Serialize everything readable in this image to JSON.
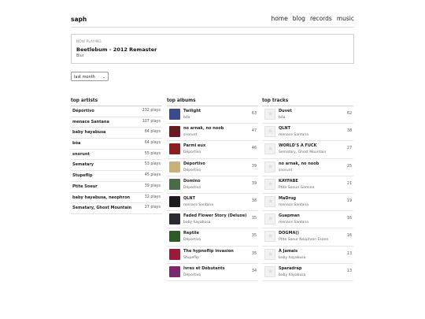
{
  "header": {
    "brand": "saph",
    "nav": [
      "home",
      "blog",
      "records",
      "music"
    ]
  },
  "now_playing": {
    "label": "NOW PLAYING",
    "title": "Beetlebum - 2012 Remaster",
    "artist": "Blur"
  },
  "period_select": {
    "value": "last month"
  },
  "top_artists": {
    "title": "top artists",
    "items": [
      {
        "name": "Déportivo",
        "plays": "232 plays"
      },
      {
        "name": "menace Santana",
        "plays": "107 plays"
      },
      {
        "name": "baby hayabusa",
        "plays": "84 plays"
      },
      {
        "name": "bôa",
        "plays": "64 plays"
      },
      {
        "name": "snorunt",
        "plays": "55 plays"
      },
      {
        "name": "Sematary",
        "plays": "53 plays"
      },
      {
        "name": "Stupeflip",
        "plays": "45 plays"
      },
      {
        "name": "Ptite Soeur",
        "plays": "39 plays"
      },
      {
        "name": "baby hayabusa, neophron",
        "plays": "32 plays"
      },
      {
        "name": "Sematary, Ghost Mountain",
        "plays": "27 plays"
      }
    ]
  },
  "top_albums": {
    "title": "top albums",
    "items": [
      {
        "name": "Twilight",
        "artist": "bôa",
        "count": "63",
        "color": "#3a4a8a"
      },
      {
        "name": "no arnak, no noob",
        "artist": "snorunt",
        "count": "47",
        "color": "#6a1a22"
      },
      {
        "name": "Parmi eux",
        "artist": "Déportivo",
        "count": "46",
        "color": "#8a1e22"
      },
      {
        "name": "Déportivo",
        "artist": "Déportivo",
        "count": "39",
        "color": "#c9b27a"
      },
      {
        "name": "Domino",
        "artist": "Déportivo",
        "count": "39",
        "color": "#4b6a4a"
      },
      {
        "name": "QLNT",
        "artist": "menace Santana",
        "count": "38",
        "color": "#1d1d1d"
      },
      {
        "name": "Faded Flower Story (Deluxe)",
        "artist": "baby hayabusa",
        "count": "35",
        "color": "#2a2a34"
      },
      {
        "name": "Reptile",
        "artist": "Déportivo",
        "count": "35",
        "color": "#2f5a2a"
      },
      {
        "name": "The hypnoflip invasion",
        "artist": "Stupeflip",
        "count": "35",
        "color": "#9a1a3a"
      },
      {
        "name": "Ivres et Débutants",
        "artist": "Déportivo",
        "count": "34",
        "color": "#7a2a6a"
      }
    ]
  },
  "top_tracks": {
    "title": "top tracks",
    "items": [
      {
        "name": "Duvet",
        "artist": "bôa",
        "count": "62"
      },
      {
        "name": "QLNT",
        "artist": "menace Santana",
        "count": "38"
      },
      {
        "name": "WORLD'S A FUCK",
        "artist": "Sematary, Ghost Mountain",
        "count": "27"
      },
      {
        "name": "no arnak, no noob",
        "artist": "snorunt",
        "count": "25"
      },
      {
        "name": "KAYFABE",
        "artist": "Ptite Soeur/ Gemino",
        "count": "21"
      },
      {
        "name": "MaDrug",
        "artist": "menace Santana",
        "count": "19"
      },
      {
        "name": "Guapman",
        "artist": "menace Santana",
        "count": "16"
      },
      {
        "name": "DOGMA()",
        "artist": "Ptite Soeur Neophron Esone",
        "count": "16"
      },
      {
        "name": "À Jamais",
        "artist": "baby hayabusa",
        "count": "13"
      },
      {
        "name": "Sparadrap",
        "artist": "baby hayabusa",
        "count": "13"
      }
    ]
  }
}
